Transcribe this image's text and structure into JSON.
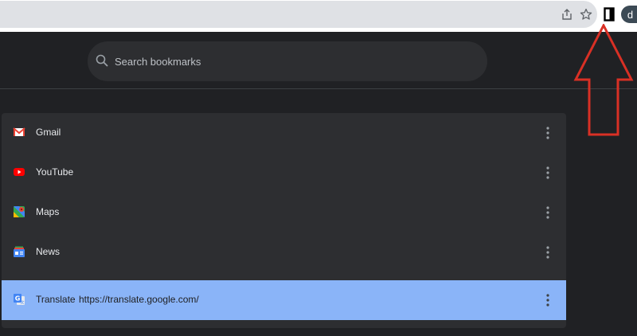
{
  "toolbar": {
    "share_icon": "share-icon",
    "bookmark_icon": "star-icon",
    "side_panel_icon": "side-panel-icon",
    "avatar_letter": "d"
  },
  "search": {
    "placeholder": "Search bookmarks",
    "value": ""
  },
  "bookmarks": [
    {
      "title": "Gmail",
      "url": "",
      "icon": "gmail-icon",
      "selected": false
    },
    {
      "title": "YouTube",
      "url": "",
      "icon": "youtube-icon",
      "selected": false
    },
    {
      "title": "Maps",
      "url": "",
      "icon": "maps-icon",
      "selected": false
    },
    {
      "title": "News",
      "url": "",
      "icon": "news-icon",
      "selected": false
    },
    {
      "title": "Translate",
      "url": "https://translate.google.com/",
      "icon": "translate-icon",
      "selected": true
    }
  ],
  "colors": {
    "page_bg": "#202124",
    "card_bg": "#2d2e31",
    "selected_bg": "#8ab4f8",
    "annotation": "#d93025"
  }
}
